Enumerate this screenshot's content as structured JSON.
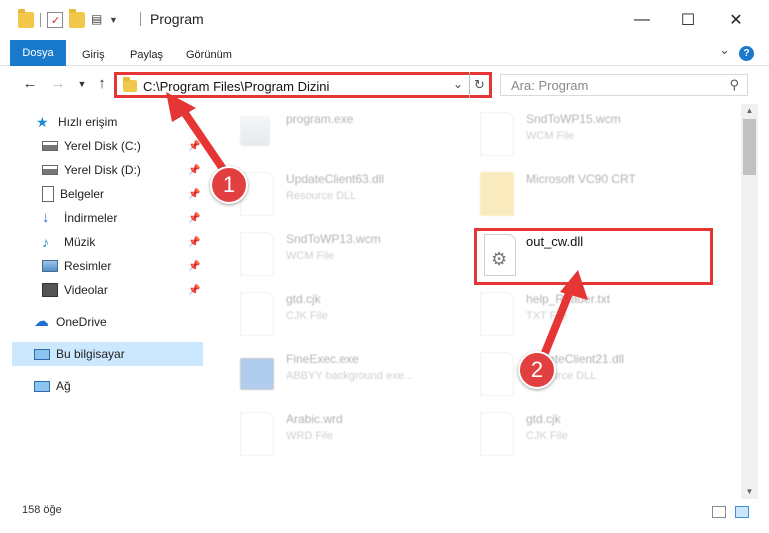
{
  "window": {
    "title": "Program",
    "minimize_icon": "—",
    "maximize_icon": "☐",
    "close_icon": "✕",
    "chevron_icon": "⌄",
    "help_icon": "?"
  },
  "ribbon": {
    "tabs": [
      "Dosya",
      "Giriş",
      "Paylaş",
      "Görünüm"
    ]
  },
  "address": {
    "path": "C:\\Program Files\\Program Dizini",
    "search_placeholder": "Ara: Program"
  },
  "nav": {
    "quick_access": "Hızlı erişim",
    "items": [
      {
        "label": "Yerel Disk (C:)",
        "icon": "disk-icon"
      },
      {
        "label": "Yerel Disk (D:)",
        "icon": "disk-icon"
      },
      {
        "label": "Belgeler",
        "icon": "documents-icon"
      },
      {
        "label": "İndirmeler",
        "icon": "download-icon"
      },
      {
        "label": "Müzik",
        "icon": "music-icon"
      },
      {
        "label": "Resimler",
        "icon": "pictures-icon"
      },
      {
        "label": "Videolar",
        "icon": "videos-icon"
      }
    ],
    "onedrive": "OneDrive",
    "this_pc": "Bu bilgisayar",
    "network": "Ağ"
  },
  "files": [
    {
      "name": "program.exe",
      "type": ""
    },
    {
      "name": "SndToWP15.wcm",
      "type": "WCM File"
    },
    {
      "name": "UpdateClient63.dll",
      "type": "Resource DLL"
    },
    {
      "name": "Microsoft VC90 CRT",
      "type": ""
    },
    {
      "name": "SndToWP13.wcm",
      "type": "WCM File"
    },
    {
      "name": "out_cw.dll",
      "type": ""
    },
    {
      "name": "gtd.cjk",
      "type": "CJK File"
    },
    {
      "name": "help_Reader.txt",
      "type": "TXT File"
    },
    {
      "name": "FineExec.exe",
      "type": "ABBYY background exe..."
    },
    {
      "name": "UpdateClient21.dll",
      "type": "Resource DLL"
    },
    {
      "name": "Arabic.wrd",
      "type": "WRD File"
    },
    {
      "name": "gtd.cjk",
      "type": "CJK File"
    }
  ],
  "status": {
    "count": "158 öğe"
  },
  "annotations": {
    "step1": "1",
    "step2": "2",
    "color": "#e53535"
  }
}
